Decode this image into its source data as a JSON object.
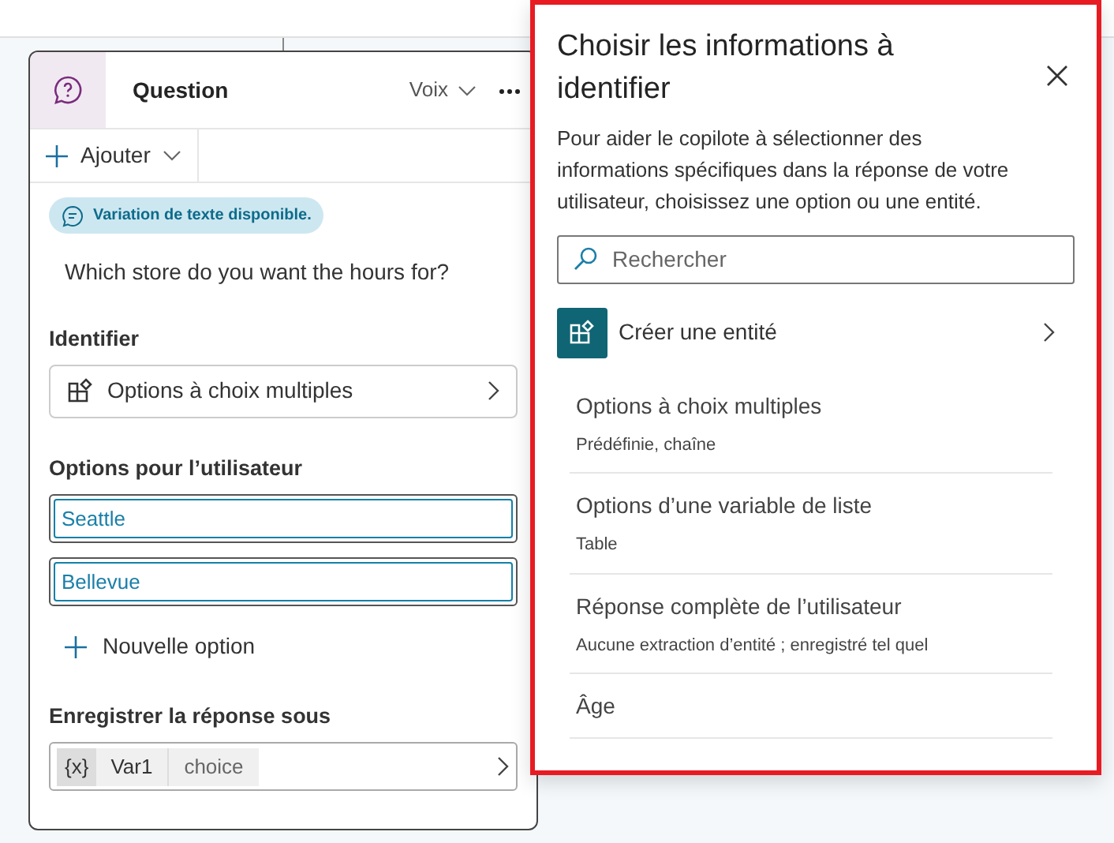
{
  "node": {
    "title": "Question",
    "voice_label": "Voix",
    "add_label": "Ajouter",
    "variation_badge": "Variation de texte disponible.",
    "message": "Which store do you want the hours for?",
    "identify_label": "Identifier",
    "identify_value": "Options à choix multiples",
    "options_label": "Options pour l’utilisateur",
    "options": [
      {
        "value": "Seattle"
      },
      {
        "value": "Bellevue"
      }
    ],
    "new_option": "Nouvelle option",
    "save_label": "Enregistrer la réponse sous",
    "variable": {
      "icon_text": "{x}",
      "name": "Var1",
      "type": "choice"
    }
  },
  "panel": {
    "title": "Choisir les informations à identifier",
    "description": "Pour aider le copilote à sélectionner des informations spécifiques dans la réponse de votre utilisateur, choisissez une option ou une entité.",
    "search": {
      "placeholder": "Rechercher"
    },
    "create_entity": "Créer une entité",
    "items": [
      {
        "title": "Options à choix multiples",
        "subtitle": "Prédéfinie, chaîne"
      },
      {
        "title": "Options d’une variable de liste",
        "subtitle": "Table"
      },
      {
        "title": "Réponse complète de l’utilisateur",
        "subtitle": "Aucune extraction d’entité ; enregistré tel quel"
      },
      {
        "title": "Âge"
      }
    ]
  }
}
